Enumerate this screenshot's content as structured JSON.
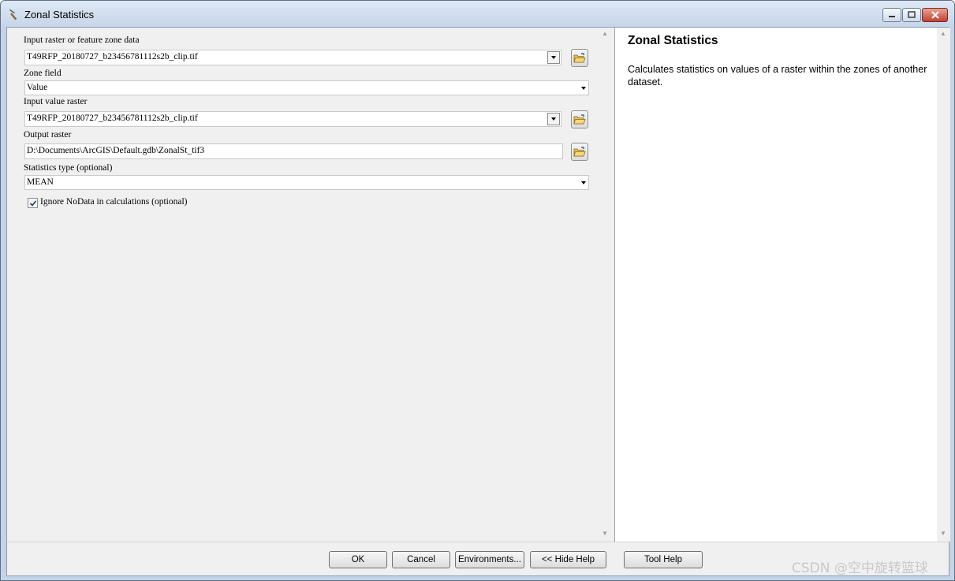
{
  "window": {
    "title": "Zonal Statistics"
  },
  "form": {
    "zone_data": {
      "label": "Input raster or feature zone data",
      "value": "T49RFP_20180727_b23456781112s2b_clip.tif"
    },
    "zone_field": {
      "label": "Zone field",
      "value": "Value"
    },
    "value_raster": {
      "label": "Input value raster",
      "value": "T49RFP_20180727_b23456781112s2b_clip.tif"
    },
    "output_raster": {
      "label": "Output raster",
      "value": "D:\\Documents\\ArcGIS\\Default.gdb\\ZonalSt_tif3"
    },
    "statistics_type": {
      "label": "Statistics type (optional)",
      "value": "MEAN"
    },
    "ignore_nodata": {
      "label": "Ignore NoData in calculations (optional)",
      "checked": true
    }
  },
  "help": {
    "title": "Zonal Statistics",
    "description": "Calculates statistics on values of a raster within the zones of another dataset."
  },
  "buttons": {
    "ok": "OK",
    "cancel": "Cancel",
    "environments": "Environments...",
    "hide_help": "<< Hide Help",
    "tool_help": "Tool Help"
  },
  "watermark": "CSDN @空中旋转篮球",
  "icons": {
    "title": "hammer-icon",
    "browse": "open-folder-icon",
    "dropdown": "chevron-down-icon"
  }
}
